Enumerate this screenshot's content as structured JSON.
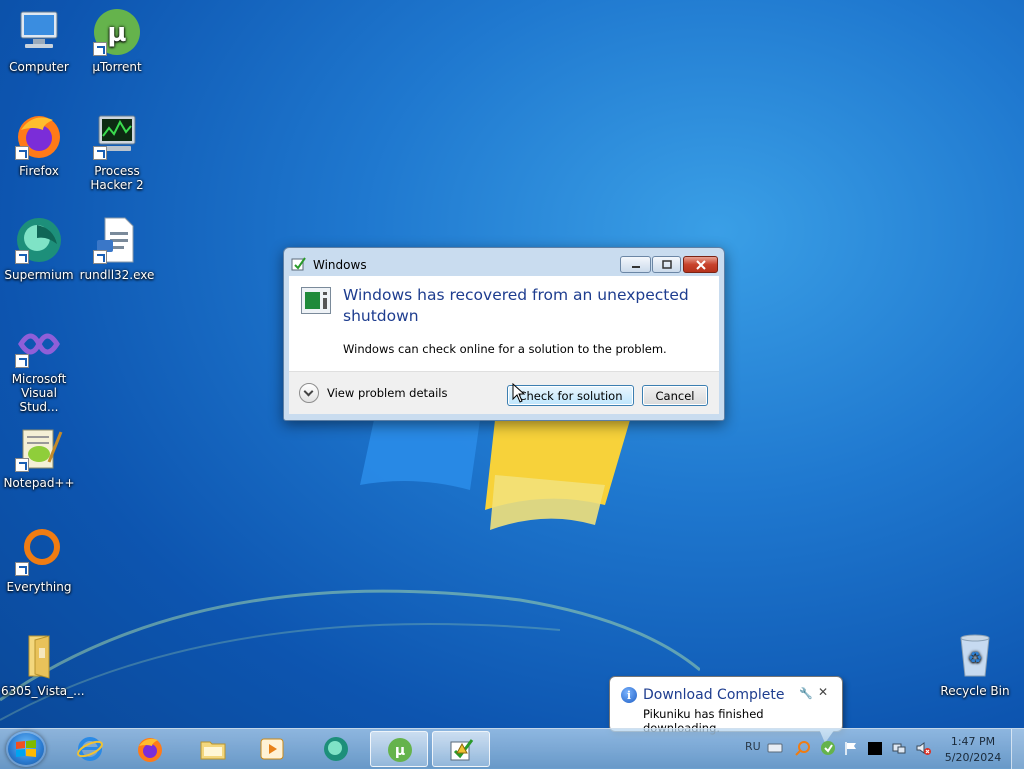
{
  "desktop": {
    "icons": [
      {
        "label": "Computer"
      },
      {
        "label": "µTorrent"
      },
      {
        "label": "Firefox"
      },
      {
        "label": "Process Hacker 2"
      },
      {
        "label": "Supermium"
      },
      {
        "label": "rundll32.exe"
      },
      {
        "label": "Microsoft Visual Stud..."
      },
      {
        "label": "Notepad++"
      },
      {
        "label": "Everything"
      },
      {
        "label": "6305_Vista_..."
      },
      {
        "label": "Recycle Bin"
      }
    ]
  },
  "dialog": {
    "title": "Windows",
    "headline": "Windows has recovered from an unexpected shutdown",
    "message": "Windows can check online for a solution to the problem.",
    "details_label": "View problem details",
    "primary_button": "Check for solution",
    "cancel_button": "Cancel"
  },
  "notification": {
    "title": "Download Complete",
    "body": "Pikuniku has finished downloading."
  },
  "taskbar": {
    "pinned": [
      "internet-explorer",
      "firefox",
      "file-explorer",
      "media-player",
      "supermium",
      "utorrent",
      "problem-reporting"
    ],
    "tray": {
      "language": "RU",
      "time": "1:47 PM",
      "date": "5/20/2024"
    }
  },
  "colors": {
    "accent_text": "#1e3d8f",
    "close_red": "#c8432c",
    "desktop_blue": "#1f78cf"
  }
}
